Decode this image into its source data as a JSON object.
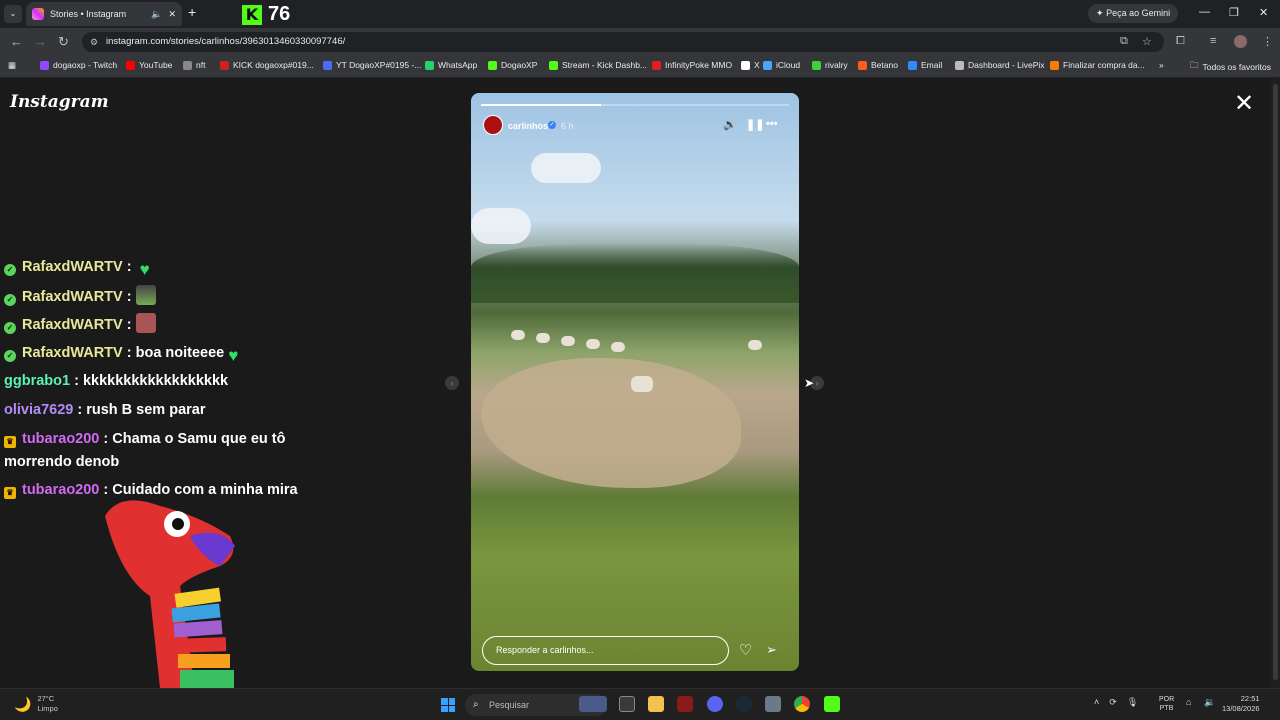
{
  "browser": {
    "tab_title": "Stories • Instagram",
    "new_tab": "+",
    "kick_count": "76",
    "gemini_label": "Peça ao Gemini",
    "url": "instagram.com/stories/carlinhos/3963013460330097746/",
    "bookmarks": [
      {
        "label": "dogaoxp - Twitch",
        "color": "#9146ff"
      },
      {
        "label": "YouTube",
        "color": "#ff0000"
      },
      {
        "label": "nft",
        "color": "#888888"
      },
      {
        "label": "KICK dogaoxp#019...",
        "color": "#cc2222"
      },
      {
        "label": "YT DogaoXP#0195 -...",
        "color": "#4a6cf7"
      },
      {
        "label": "WhatsApp",
        "color": "#25d366"
      },
      {
        "label": "DogaoXP",
        "color": "#53fc18"
      },
      {
        "label": "Stream - Kick Dashb...",
        "color": "#53fc18"
      },
      {
        "label": "InfinityPoke MMO",
        "color": "#e02020"
      },
      {
        "label": "X",
        "color": "#ffffff"
      },
      {
        "label": "iCloud",
        "color": "#4aa3ff"
      },
      {
        "label": "rivalry",
        "color": "#3bd13b"
      },
      {
        "label": "Betano",
        "color": "#ff5a1f"
      },
      {
        "label": "Email",
        "color": "#2d8cff"
      },
      {
        "label": "Dashboard - LivePix",
        "color": "#bbbbbb"
      },
      {
        "label": "Finalizar compra da...",
        "color": "#ff7a00"
      }
    ],
    "all_bookmarks": "Todos os favoritos"
  },
  "instagram": {
    "logo": "Instagram",
    "story": {
      "username": "carlinhos",
      "time": "6 h",
      "progress": 0.39,
      "reply_placeholder": "Responder a carlinhos..."
    }
  },
  "chat": [
    {
      "user": "RafaxdWARTV",
      "user_color": "#e8e89a",
      "badge": "check",
      "message": "",
      "emoji": "green-heart"
    },
    {
      "user": "RafaxdWARTV",
      "user_color": "#e8e89a",
      "badge": "check",
      "message": "",
      "emoji": "dancer-sticker"
    },
    {
      "user": "RafaxdWARTV",
      "user_color": "#e8e89a",
      "badge": "check",
      "message": "",
      "emoji": "face-sticker"
    },
    {
      "user": "RafaxdWARTV",
      "user_color": "#e8e89a",
      "badge": "check",
      "message": "boa noiteeee",
      "emoji": "green-heart"
    },
    {
      "user": "ggbrabo1",
      "user_color": "#5cf2b0",
      "badge": "",
      "message": "kkkkkkkkkkkkkkkkkk",
      "emoji": ""
    },
    {
      "user": "olivia7629",
      "user_color": "#b28cf7",
      "badge": "",
      "message": "rush B sem parar",
      "emoji": ""
    },
    {
      "user": "tubarao200",
      "user_color": "#cf6bf0",
      "badge": "crown",
      "message": "Chama o Samu que eu tô morrendo denob",
      "emoji": ""
    },
    {
      "user": "tubarao200",
      "user_color": "#cf6bf0",
      "badge": "crown",
      "message": "Cuidado com a minha mira",
      "emoji": ""
    }
  ],
  "taskbar": {
    "weather_temp": "27°C",
    "weather_desc": "Limpo",
    "search_placeholder": "Pesquisar",
    "lang1": "POR",
    "lang2": "PTB",
    "time": "22:51",
    "date": "13/08/2026"
  }
}
